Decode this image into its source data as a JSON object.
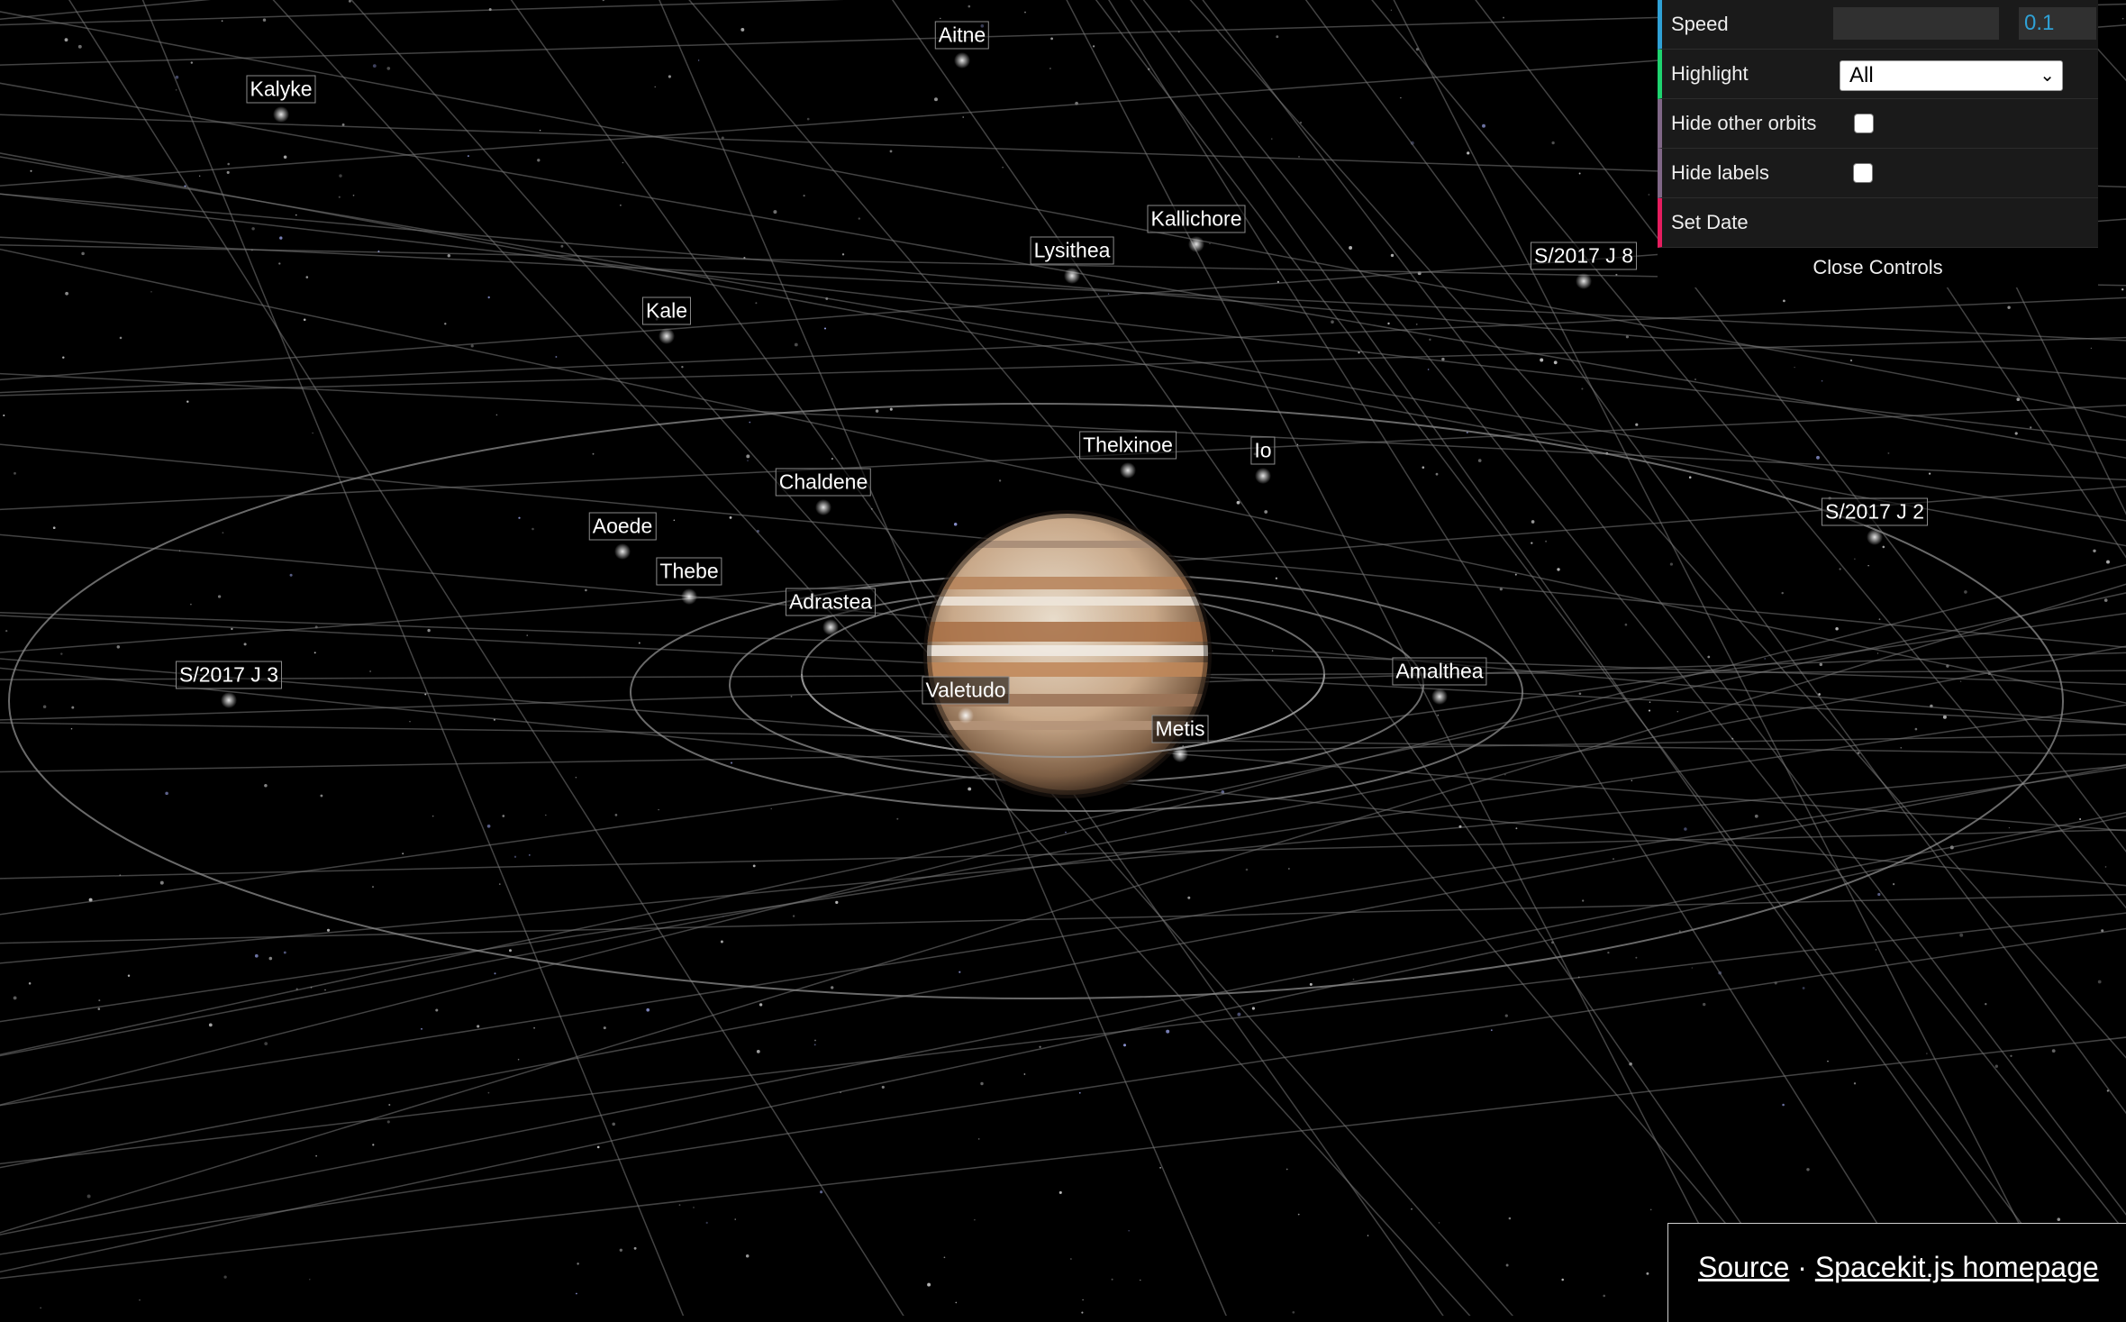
{
  "moons": [
    {
      "name": "Aitne"
    },
    {
      "name": "Kalyke"
    },
    {
      "name": "Kallichore"
    },
    {
      "name": "Lysithea"
    },
    {
      "name": "S/2017 J 8"
    },
    {
      "name": "Kale"
    },
    {
      "name": "Thelxinoe"
    },
    {
      "name": "Io"
    },
    {
      "name": "Chaldene"
    },
    {
      "name": "S/2017 J 2"
    },
    {
      "name": "Aoede"
    },
    {
      "name": "Thebe"
    },
    {
      "name": "Adrastea"
    },
    {
      "name": "Amalthea"
    },
    {
      "name": "S/2017 J 3"
    },
    {
      "name": "Valetudo"
    },
    {
      "name": "Metis"
    }
  ],
  "controls": {
    "speed_label": "Speed",
    "speed_value": "0.1",
    "speed_fraction": 0.0,
    "highlight_label": "Highlight",
    "highlight_value": "All",
    "hide_orbits_label": "Hide other orbits",
    "hide_orbits_checked": false,
    "hide_labels_label": "Hide labels",
    "hide_labels_checked": false,
    "set_date_label": "Set Date",
    "close_label": "Close Controls"
  },
  "footer": {
    "source_label": "Source",
    "separator": "·",
    "homepage_label": "Spacekit.js homepage"
  },
  "colors": {
    "speed_accent": "#2fa1d6",
    "highlight_accent": "#1ed36f",
    "boolean_accent": "#806787",
    "function_accent": "#e61d5f"
  }
}
